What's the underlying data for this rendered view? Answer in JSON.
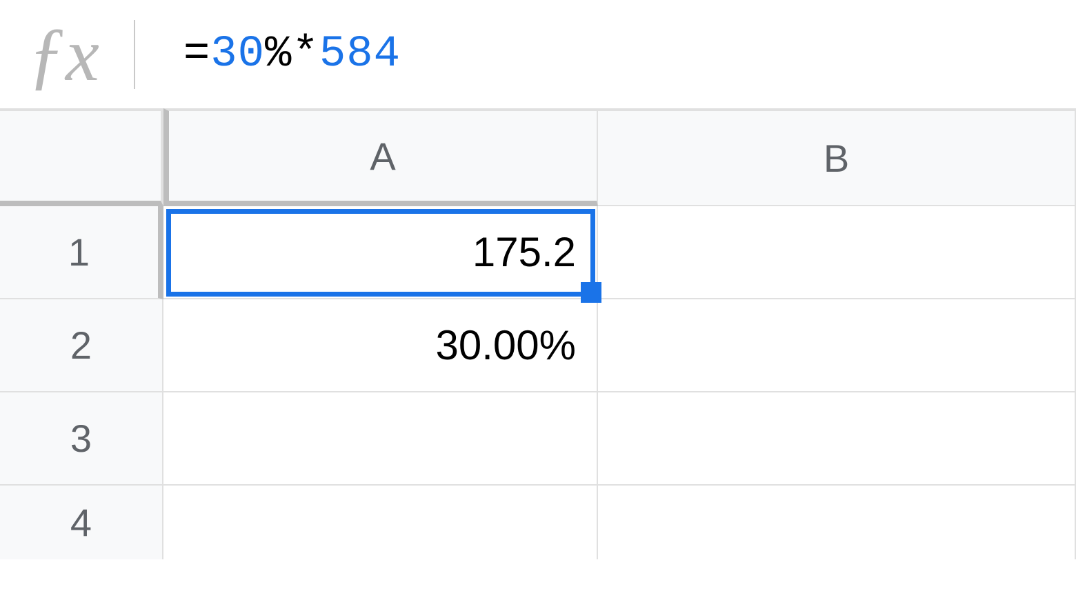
{
  "formula": {
    "tokens": [
      {
        "text": "=",
        "cls": "tok-black"
      },
      {
        "text": "30",
        "cls": "tok-blue"
      },
      {
        "text": "%*",
        "cls": "tok-black"
      },
      {
        "text": "584",
        "cls": "tok-blue"
      }
    ]
  },
  "columns": {
    "a": "A",
    "b": "B"
  },
  "rows": {
    "r1": "1",
    "r2": "2",
    "r3": "3",
    "r4": "4"
  },
  "cells": {
    "a1": "175.2",
    "a2": "30.00%",
    "a3": "",
    "a4": "",
    "b1": "",
    "b2": "",
    "b3": "",
    "b4": ""
  },
  "selection": {
    "cell": "A1"
  }
}
